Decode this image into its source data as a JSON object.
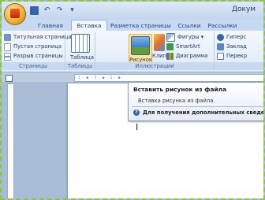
{
  "window": {
    "title": "Докум"
  },
  "quick_access": [
    "save-icon",
    "undo-icon",
    "redo-icon",
    "customize-icon"
  ],
  "tabs": [
    {
      "label": "Главная"
    },
    {
      "label": "Вставка",
      "active": true
    },
    {
      "label": "Разметка страницы"
    },
    {
      "label": "Ссылки"
    },
    {
      "label": "Рассылки"
    }
  ],
  "ribbon": {
    "pages": {
      "items": [
        "Титульная страница ▾",
        "Пустая страница",
        "Разрыв страницы"
      ],
      "label": "Страницы"
    },
    "tables": {
      "button": "Таблица",
      "label": "Таблицы"
    },
    "illustrations": {
      "picture": "Рисунок",
      "clip": "Клип",
      "shapes": "Фигуры ▾",
      "smartart": "SmartArt",
      "chart": "Диаграмма",
      "label": "Иллюстрации"
    },
    "links": {
      "items": [
        "Гиперс",
        "Заклад",
        "Перекр"
      ]
    }
  },
  "ruler": {
    "text": "· 1 · ▪ · 2 · ▪ · 1 · ▪"
  },
  "tooltip": {
    "title": "Вставить рисунок из файла",
    "description": "Вставка рисунка из файла.",
    "help": "Для получения дополнительных сведен"
  },
  "document": {
    "cursor": "I"
  },
  "colors": {
    "accent": "#15428b",
    "ribbon_bg": "#dfe9f6",
    "highlight": "#ffe49a"
  }
}
